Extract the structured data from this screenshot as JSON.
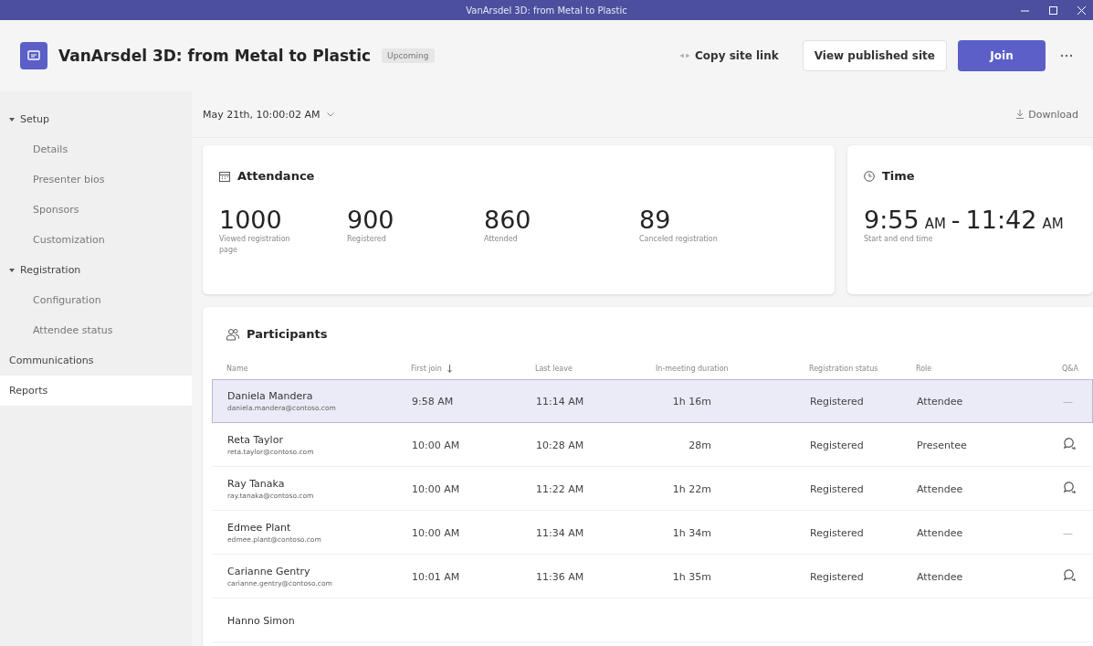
{
  "window": {
    "title": "VanArsdel 3D: from Metal to Plastic"
  },
  "header": {
    "title": "VanArsdel 3D: from Metal to Plastic",
    "badge": "Upcoming",
    "copy_link": "Copy site link",
    "view_site": "View published site",
    "join": "Join"
  },
  "sidebar": {
    "items": [
      {
        "label": "Setup",
        "expanded": true,
        "selected": false,
        "children": [
          {
            "label": "Details",
            "selected": false
          },
          {
            "label": "Presenter bios",
            "selected": false
          },
          {
            "label": "Sponsors",
            "selected": false
          },
          {
            "label": "Customization",
            "selected": false
          }
        ]
      },
      {
        "label": "Registration",
        "expanded": true,
        "selected": false,
        "children": [
          {
            "label": "Configuration",
            "selected": false
          },
          {
            "label": "Attendee status",
            "selected": false
          }
        ]
      },
      {
        "label": "Communications",
        "selected": false
      },
      {
        "label": "Reports",
        "selected": true
      }
    ]
  },
  "date_bar": {
    "session": "May 21th, 10:00:02 AM",
    "download": "Download"
  },
  "attendance": {
    "title": "Attendance",
    "stats": [
      {
        "value": "1000",
        "label": "Viewed registration page"
      },
      {
        "value": "900",
        "label": "Registered"
      },
      {
        "value": "860",
        "label": "Attended"
      },
      {
        "value": "89",
        "label": "Canceled registration"
      }
    ]
  },
  "time": {
    "title": "Time",
    "start": "9:55",
    "start_period": "AM",
    "separator": "-",
    "end": "11:42",
    "end_period": "AM",
    "label": "Start and end time"
  },
  "participants": {
    "title": "Participants",
    "columns": [
      "Name",
      "First join",
      "Last leave",
      "In-meeting duration",
      "Registration status",
      "Role",
      "Q&A"
    ],
    "rows": [
      {
        "name": "Daniela Mandera",
        "email": "daniela.mandera@contoso.com",
        "first_join": "9:58 AM",
        "last_leave": "11:14 AM",
        "duration": "1h 16m",
        "status": "Registered",
        "role": "Attendee",
        "qa": {
          "kind": "text",
          "text": "—"
        },
        "selected": true
      },
      {
        "name": "Reta Taylor",
        "email": "reta.taylor@contoso.com",
        "first_join": "10:00 AM",
        "last_leave": "10:28 AM",
        "duration": "28m",
        "status": "Registered",
        "role": "Presentee",
        "qa": {
          "kind": "icon"
        },
        "selected": false
      },
      {
        "name": "Ray Tanaka",
        "email": "ray.tanaka@contoso.com",
        "first_join": "10:00 AM",
        "last_leave": "11:22 AM",
        "duration": "1h 22m",
        "status": "Registered",
        "role": "Attendee",
        "qa": {
          "kind": "icon"
        },
        "selected": false
      },
      {
        "name": "Edmee Plant",
        "email": "edmee.plant@contoso.com",
        "first_join": "10:00 AM",
        "last_leave": "11:34 AM",
        "duration": "1h 34m",
        "status": "Registered",
        "role": "Attendee",
        "qa": {
          "kind": "text",
          "text": "—"
        },
        "selected": false
      },
      {
        "name": "Carianne Gentry",
        "email": "carianne.gentry@contoso.com",
        "first_join": "10:01 AM",
        "last_leave": "11:36 AM",
        "duration": "1h 35m",
        "status": "Registered",
        "role": "Attendee",
        "qa": {
          "kind": "icon"
        },
        "selected": false
      },
      {
        "name": "Hanno Simon",
        "selected": false
      }
    ]
  }
}
